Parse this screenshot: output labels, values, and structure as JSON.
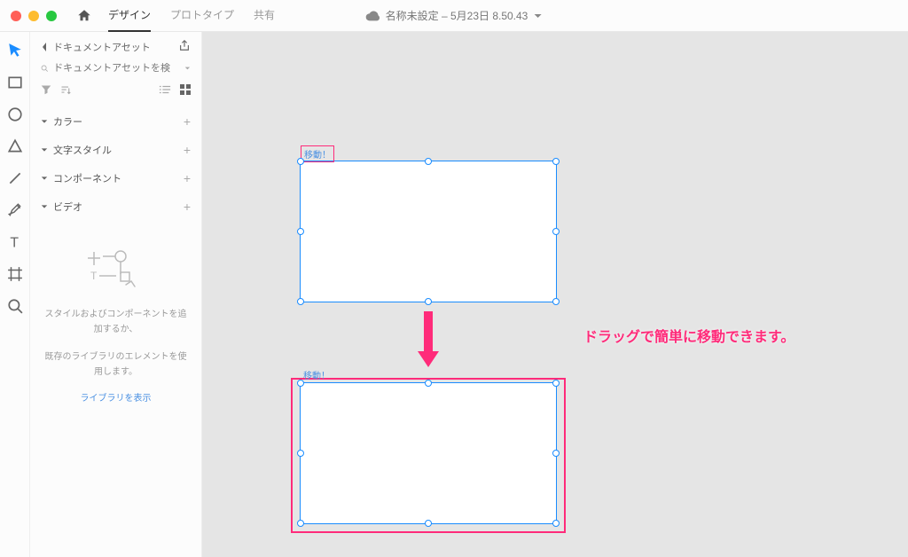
{
  "titlebar": {
    "tabs": {
      "design": "デザイン",
      "prototype": "プロトタイプ",
      "share": "共有"
    },
    "doc_title": "名称未設定 – 5月23日 8.50.43"
  },
  "panel": {
    "back_label": "ドキュメントアセット",
    "search_placeholder": "ドキュメントアセットを検",
    "sections": {
      "color": "カラー",
      "textstyle": "文字スタイル",
      "component": "コンポーネント",
      "video": "ビデオ"
    },
    "empty_line1": "スタイルおよびコンポーネントを追加するか、",
    "empty_line2": "既存のライブラリのエレメントを使用します。",
    "library_link": "ライブラリを表示"
  },
  "canvas": {
    "artboard1_label": "移動！",
    "artboard2_label": "移動！",
    "annotation": "ドラッグで簡単に移動できます。"
  }
}
